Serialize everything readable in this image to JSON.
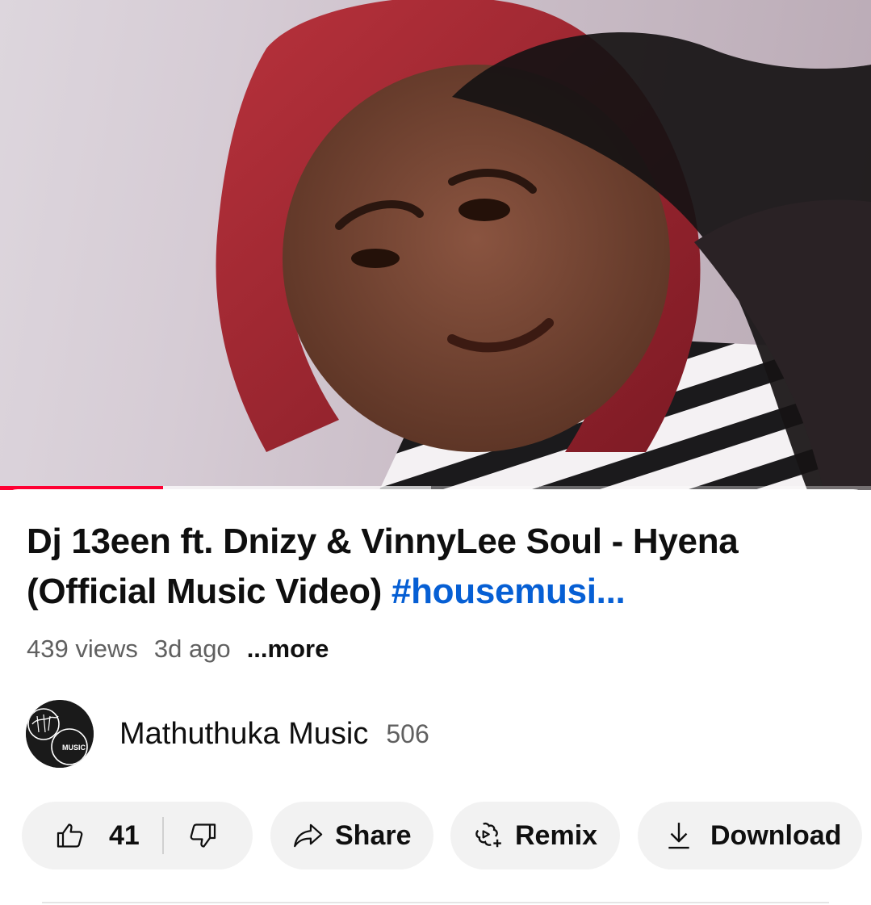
{
  "video": {
    "progress": 0.187,
    "buffered": 0.495
  },
  "title": {
    "text": "Dj 13een ft. Dnizy &  VinnyLee Soul - Hyena (Official Music Video) ",
    "hashtag": "#housemusi..."
  },
  "meta": {
    "views": "439 views",
    "age": "3d ago",
    "more": "...more"
  },
  "channel": {
    "name": "Mathuthuka Music",
    "subscribers": "506",
    "avatar_text": "MUSIC"
  },
  "actions": {
    "like_count": "41",
    "share_label": "Share",
    "remix_label": "Remix",
    "download_label": "Download"
  },
  "colors": {
    "progress": "#ff0033",
    "hashtag": "#065fd4",
    "pill_bg": "#f2f2f2"
  },
  "icons": [
    "thumbs-up-icon",
    "thumbs-down-icon",
    "share-arrow-icon",
    "remix-icon",
    "download-icon"
  ]
}
